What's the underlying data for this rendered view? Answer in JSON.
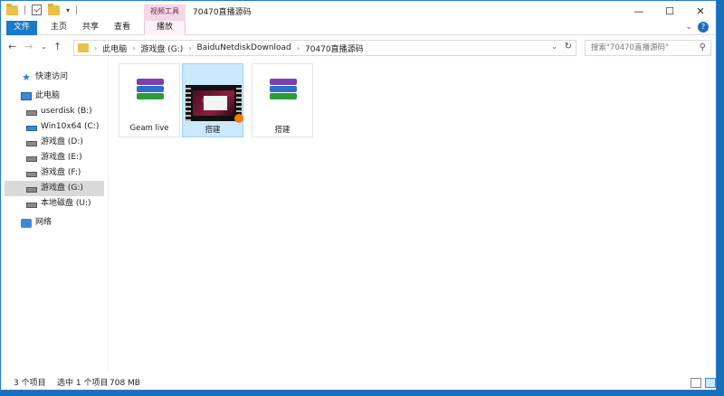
{
  "window": {
    "title": "70470直播源码",
    "context_tool": "视频工具",
    "controls": [
      "—",
      "☐",
      "✕"
    ]
  },
  "ribbon": {
    "tabs": [
      "文件",
      "主页",
      "共享",
      "查看",
      "播放"
    ],
    "help": "?"
  },
  "address": {
    "crumbs": [
      "此电脑",
      "游戏盘 (G:)",
      "BaiduNetdiskDownload",
      "70470直播源码"
    ],
    "search_placeholder": "搜索\"70470直播源码\""
  },
  "sidebar": {
    "quick_access": "快速访问",
    "this_pc": "此电脑",
    "drives": [
      "userdisk (B:)",
      "Win10x64 (C:)",
      "游戏盘 (D:)",
      "游戏盘 (E:)",
      "游戏盘 (F:)",
      "游戏盘 (G:)",
      "本地磁盘 (U:)"
    ],
    "selected_drive": "游戏盘 (G:)",
    "network": "网络"
  },
  "files": [
    {
      "name": "Geam live",
      "type": "rar-archive",
      "selected": false
    },
    {
      "name": "搭建",
      "type": "video",
      "selected": true
    },
    {
      "name": "搭建",
      "type": "rar-archive",
      "selected": false
    }
  ],
  "status": {
    "count": "3 个项目",
    "selection": "选中 1 个项目",
    "size": "708 MB"
  }
}
